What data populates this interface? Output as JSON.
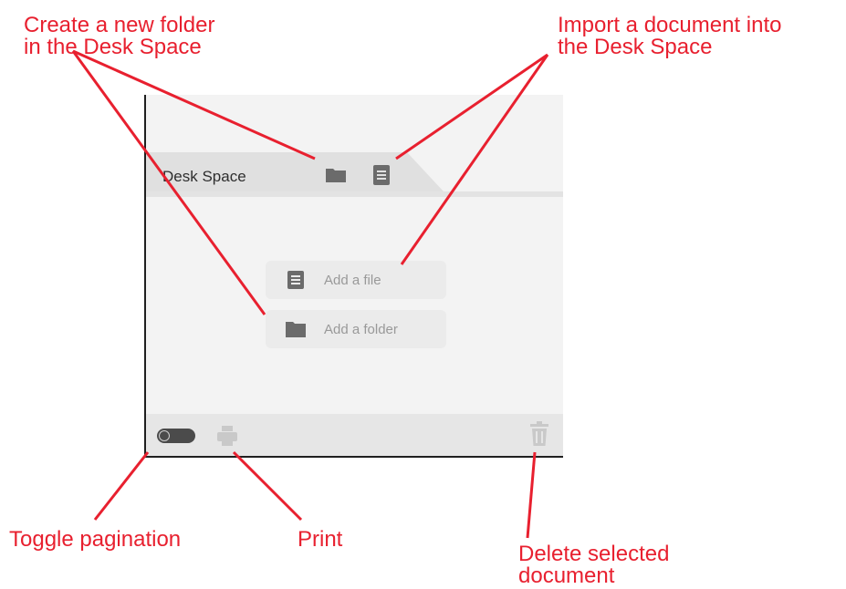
{
  "annotations": {
    "create_folder": "Create a new folder\nin the Desk Space",
    "import_document": "Import a document into\nthe Desk Space",
    "toggle_pagination": "Toggle pagination",
    "print": "Print",
    "delete": "Delete selected\ndocument"
  },
  "tab": {
    "title": "Desk Space"
  },
  "empty_actions": {
    "add_file": "Add a file",
    "add_folder": "Add a folder"
  },
  "colors": {
    "annotation": "#e8202f",
    "icon_dark": "#6b6b6b",
    "icon_light": "#c9c9c9"
  }
}
